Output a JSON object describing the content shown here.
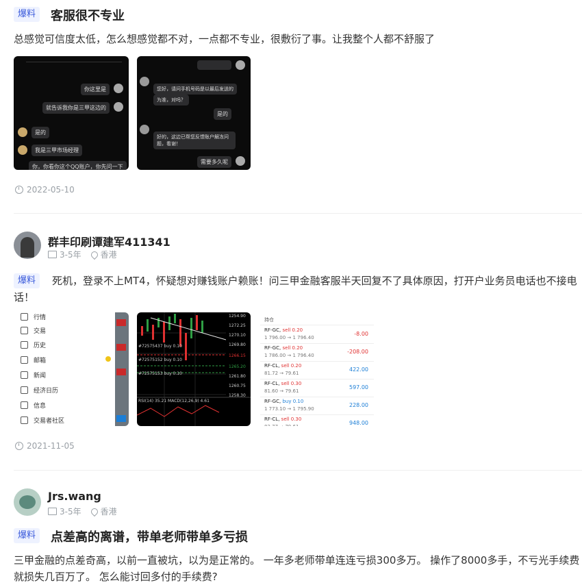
{
  "post1": {
    "tag": "爆料",
    "title": "客服很不专业",
    "body": "总感觉可信度太低，怎么想感觉都不对，一点都不专业，很敷衍了事。让我整个人都不舒服了",
    "date": "2022-05-10",
    "chat1": {
      "bubbles": [
        "你这里是",
        "就告诉我你是三甲这边的",
        "是的",
        "我是三甲市场经理",
        "你，你看你这个QQ账户，你先问一下"
      ]
    },
    "chat2": {
      "bubbles": [
        "您好，请问手机号码是以最后发送的",
        "为准，对吗？",
        "是的",
        "好的，这边已帮您反馈账户解冻问题，看谢！",
        "需要多久呢"
      ]
    }
  },
  "post2": {
    "username": "群丰印刷谭建军411341",
    "experience": "3-5年",
    "location": "香港",
    "tag": "爆料",
    "body": "死机，登录不上MT4，怀疑想对赚钱账户赖账！问三甲金融客服半天回复不了具体原因，打开户业务员电话也不接电话！",
    "date": "2021-11-05",
    "menu_items": [
      "行情",
      "交易",
      "历史",
      "邮箱",
      "新闻",
      "经济日历",
      "信息",
      "交易者社区"
    ],
    "chart_labels": [
      "1254.90",
      "1272.25",
      "1270.10",
      "1269.80",
      "1266.15",
      "1265.20",
      "1261.80",
      "1260.75",
      "1258.30"
    ],
    "chart_texts": [
      "#72575437 buy 0.10",
      "#72575152 buy 0.10",
      "#72575153 buy 0.10",
      "RSI(14) 35.21 MACD(12,26,9) 4.61"
    ],
    "trade_header": "持仓",
    "trades": [
      {
        "symbol": "RF-GC,",
        "side": "sell 0.20",
        "prices": "1 796.00 → 1 796.40",
        "pnl": "-8.00",
        "neg": true
      },
      {
        "symbol": "RF-GC,",
        "side": "sell 0.20",
        "prices": "1 786.00 → 1 796.40",
        "pnl": "-208.00",
        "neg": true
      },
      {
        "symbol": "RF-CL,",
        "side": "sell 0.20",
        "prices": "81.72 → 79.61",
        "pnl": "422.00",
        "neg": false
      },
      {
        "symbol": "RF-CL,",
        "side": "sell 0.30",
        "prices": "81.60 → 79.61",
        "pnl": "597.00",
        "neg": false
      },
      {
        "symbol": "RF-GC,",
        "side": "buy 0.10",
        "prices": "1 773.10 → 1 795.90",
        "pnl": "228.00",
        "neg": false
      },
      {
        "symbol": "RF-CL,",
        "side": "sell 0.30",
        "prices": "82.77 → 79.61",
        "pnl": "948.00",
        "neg": false
      }
    ]
  },
  "post3": {
    "username": "Jrs.wang",
    "experience": "3-5年",
    "location": "香港",
    "tag": "爆料",
    "title": "点差高的离谱，带单老师带单多亏损",
    "body": "三甲金融的点差奇高，以前一直被坑，以为是正常的。 一年多老师带单连连亏损300多万。 操作了8000多手，不亏光手续费就损失几百万了。 怎么能讨回多付的手续费?"
  }
}
